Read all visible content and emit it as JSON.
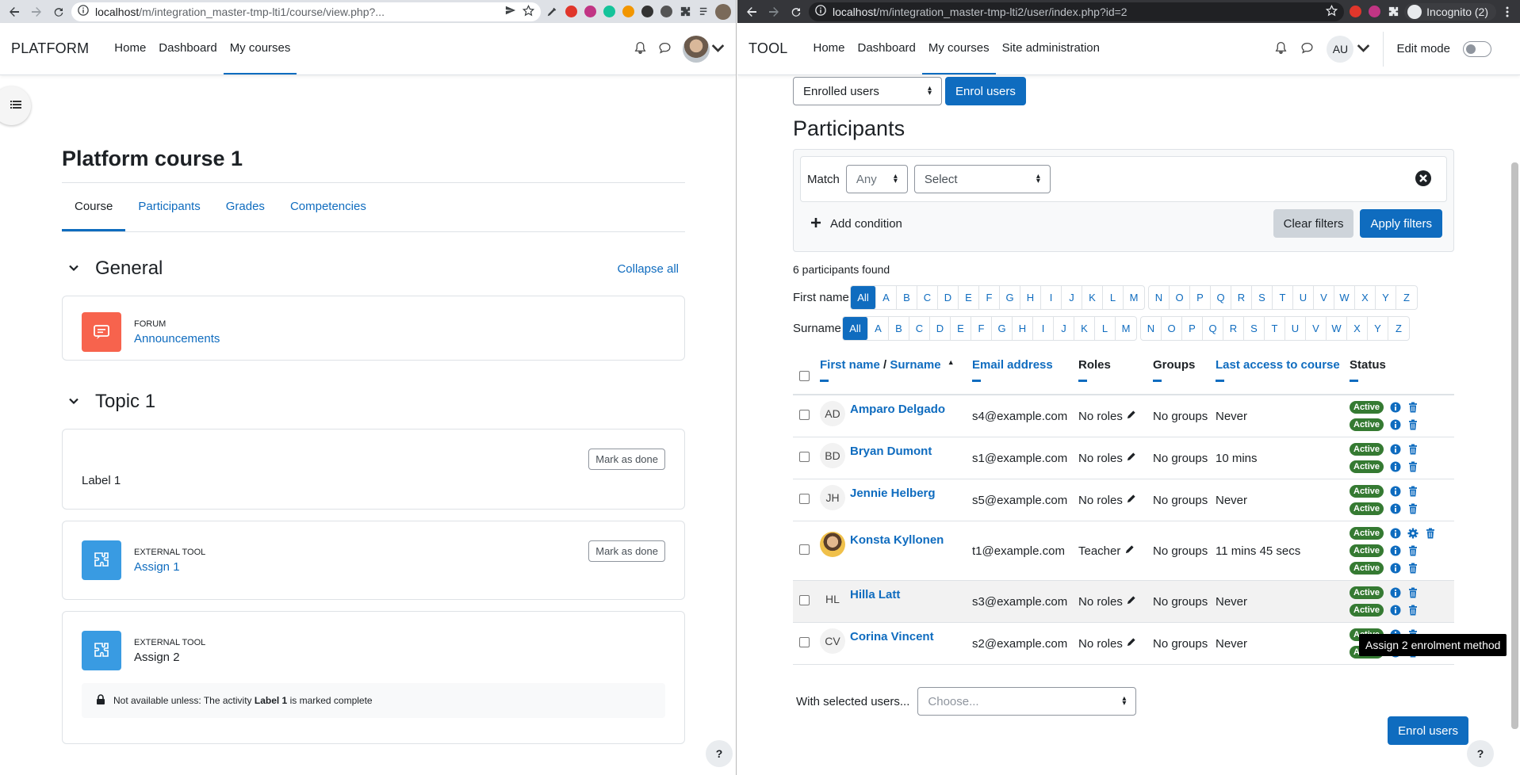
{
  "left_browser": {
    "url_host": "localhost",
    "url_path": "/m/integration_master-tmp-lti1/course/view.php?...",
    "extensions": [
      {
        "name": "ext-red-icon",
        "color": "#e0362b"
      },
      {
        "name": "ext-instagram-icon",
        "color": "#c13584"
      },
      {
        "name": "ext-grammarly-icon",
        "color": "#15c39a"
      },
      {
        "name": "ext-orange-icon",
        "color": "#f29600"
      },
      {
        "name": "ext-dark-icon",
        "color": "#333333"
      },
      {
        "name": "ext-pull-icon",
        "color": "#555555"
      }
    ]
  },
  "right_browser": {
    "url_host": "localhost",
    "url_path": "/m/integration_master-tmp-lti2/user/index.php?id=2",
    "incognito_label": "Incognito (2)"
  },
  "platform": {
    "brand": "PLATFORM",
    "nav": [
      "Home",
      "Dashboard",
      "My courses"
    ],
    "course_title": "Platform course 1",
    "tabs": [
      "Course",
      "Participants",
      "Grades",
      "Competencies"
    ],
    "collapse_all": "Collapse all",
    "sections": [
      {
        "title": "General"
      },
      {
        "title": "Topic 1"
      }
    ],
    "forum": {
      "type": "FORUM",
      "name": "Announcements"
    },
    "label1": {
      "text": "Label 1",
      "button": "Mark as done"
    },
    "assign1": {
      "type": "EXTERNAL TOOL",
      "name": "Assign 1",
      "button": "Mark as done"
    },
    "assign2": {
      "type": "EXTERNAL TOOL",
      "name": "Assign 2",
      "restriction_prefix": "Not available unless: The activity ",
      "restriction_bold": "Label 1",
      "restriction_suffix": " is marked complete"
    },
    "help": "?"
  },
  "tool": {
    "brand": "TOOL",
    "nav": [
      "Home",
      "Dashboard",
      "My courses",
      "Site administration"
    ],
    "avatar": "AU",
    "edit_mode": "Edit mode",
    "enrolled_select": "Enrolled users",
    "enrol_users": "Enrol users",
    "title": "Participants",
    "filter": {
      "match_label": "Match",
      "match_value": "Any",
      "select_value": "Select",
      "add_condition": "Add condition",
      "clear": "Clear filters",
      "apply": "Apply filters"
    },
    "found": "6 participants found",
    "firstname_label": "First name",
    "surname_label": "Surname",
    "all": "All",
    "letters1": [
      "A",
      "B",
      "C",
      "D",
      "E",
      "F",
      "G",
      "H",
      "I",
      "J",
      "K",
      "L",
      "M"
    ],
    "letters2": [
      "N",
      "O",
      "P",
      "Q",
      "R",
      "S",
      "T",
      "U",
      "V",
      "W",
      "X",
      "Y",
      "Z"
    ],
    "columns": {
      "first_name": "First name",
      "slash": " / ",
      "surname": "Surname",
      "email": "Email address",
      "roles": "Roles",
      "groups": "Groups",
      "last_access": "Last access to course",
      "status": "Status"
    },
    "rows": [
      {
        "initials": "AD",
        "name": "Amparo Delgado",
        "email": "s4@example.com",
        "role": "No roles",
        "groups": "No groups",
        "access": "Never",
        "statuses": [
          "Active",
          "Active"
        ]
      },
      {
        "initials": "BD",
        "name": "Bryan Dumont",
        "email": "s1@example.com",
        "role": "No roles",
        "groups": "No groups",
        "access": "10 mins",
        "statuses": [
          "Active",
          "Active"
        ]
      },
      {
        "initials": "JH",
        "name": "Jennie Helberg",
        "email": "s5@example.com",
        "role": "No roles",
        "groups": "No groups",
        "access": "Never",
        "statuses": [
          "Active",
          "Active"
        ]
      },
      {
        "initials": "",
        "name": "Konsta Kyllonen",
        "email": "t1@example.com",
        "role": "Teacher",
        "groups": "No groups",
        "access": "11 mins 45 secs",
        "statuses": [
          "Active",
          "Active",
          "Active"
        ]
      },
      {
        "initials": "HL",
        "name": "Hilla Latt",
        "email": "s3@example.com",
        "role": "No roles",
        "groups": "No groups",
        "access": "Never",
        "statuses": [
          "Active",
          "Active"
        ]
      },
      {
        "initials": "CV",
        "name": "Corina Vincent",
        "email": "s2@example.com",
        "role": "No roles",
        "groups": "No groups",
        "access": "Never",
        "statuses": [
          "Active",
          "Active"
        ]
      }
    ],
    "tooltip": "Assign 2 enrolment method",
    "with_selected": "With selected users...",
    "choose": "Choose...",
    "enrol_users_bottom": "Enrol users",
    "help": "?"
  }
}
